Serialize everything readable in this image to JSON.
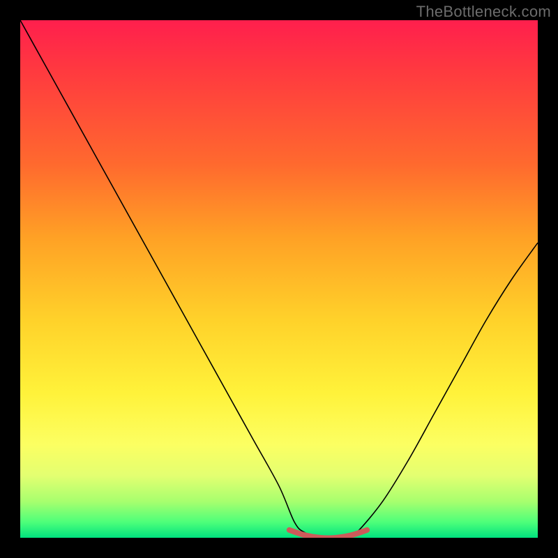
{
  "watermark": "TheBottleneck.com",
  "chart_data": {
    "type": "line",
    "title": "",
    "xlabel": "",
    "ylabel": "",
    "xlim": [
      0,
      100
    ],
    "ylim": [
      0,
      100
    ],
    "series": [
      {
        "name": "bottleneck-curve",
        "x": [
          0,
          5,
          10,
          15,
          20,
          25,
          30,
          35,
          40,
          45,
          50,
          53,
          55,
          58,
          60,
          63,
          65,
          70,
          75,
          80,
          85,
          90,
          95,
          100
        ],
        "y": [
          100,
          91,
          82,
          73,
          64,
          55,
          46,
          37,
          28,
          19,
          10,
          3,
          1,
          0,
          0,
          0,
          1,
          7,
          15,
          24,
          33,
          42,
          50,
          57
        ]
      },
      {
        "name": "flat-bottom-highlight",
        "x": [
          52,
          55,
          58,
          61,
          64,
          67
        ],
        "y": [
          1.5,
          0.5,
          0,
          0,
          0.5,
          1.5
        ]
      }
    ],
    "colors": {
      "curve": "#000000",
      "highlight": "#cd5a5a",
      "gradient_top": "#ff1f4d",
      "gradient_bottom": "#00e27e"
    }
  }
}
